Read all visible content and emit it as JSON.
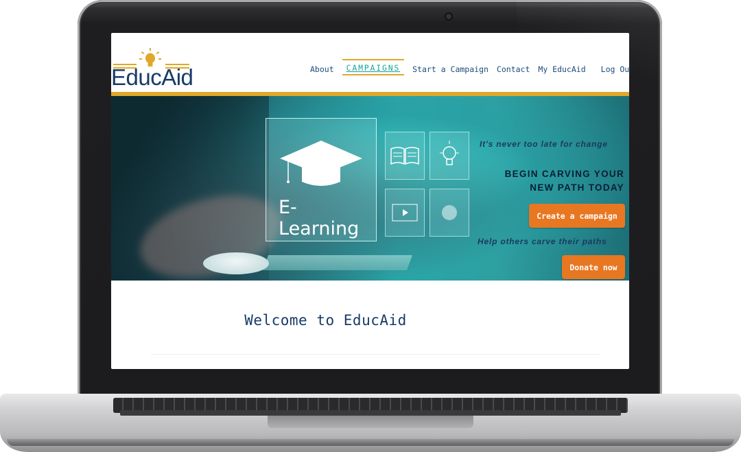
{
  "brand": {
    "name": "EducAid",
    "accent_gold": "#e0a82a",
    "navy": "#163b68",
    "teal": "#18a39c",
    "orange": "#e87722"
  },
  "nav": {
    "items": [
      {
        "label": "About"
      },
      {
        "label": "CAMPAIGNS",
        "active": true
      },
      {
        "label": "Start a Campaign"
      },
      {
        "label": "Contact"
      },
      {
        "label": "My EducAid"
      },
      {
        "label": "Log Out"
      }
    ]
  },
  "hero": {
    "image_label": "E-Learning",
    "tagline_top": "It's never too late for change",
    "headline_line1": "BEGIN CARVING YOUR",
    "headline_line2": "NEW PATH TODAY",
    "create_button": "Create a campaign",
    "tagline_bottom": "Help others carve their paths",
    "donate_button": "Donate now"
  },
  "main": {
    "welcome_heading": "Welcome to EducAid"
  },
  "icons": [
    "lightbulb-icon",
    "graduation-cap-icon",
    "open-book-icon",
    "idea-bulb-icon",
    "play-icon",
    "globe-icon"
  ]
}
